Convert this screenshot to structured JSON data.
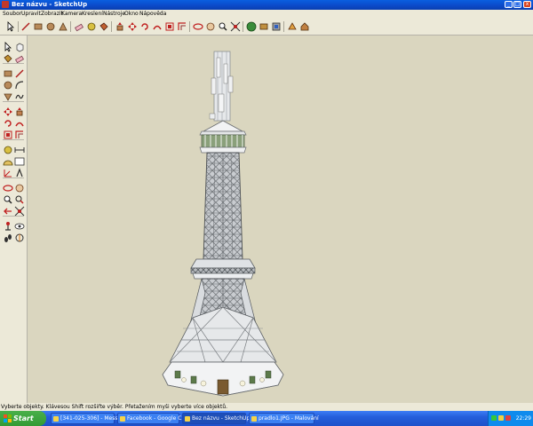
{
  "window": {
    "title": "Bez názvu - SketchUp",
    "min_label": "_",
    "max_label": "□",
    "close_label": "x"
  },
  "menu": [
    "Soubor",
    "Upravit",
    "Zobrazit",
    "Kamera",
    "Kreslení",
    "Nástroje",
    "Okno",
    "Nápověda"
  ],
  "toolbar_icons": [
    "select-icon",
    "line-icon",
    "rectangle-icon",
    "circle-icon",
    "polygon-icon",
    "eraser-icon",
    "tape-measure-icon",
    "paint-bucket-icon",
    "push-pull-icon",
    "move-icon",
    "rotate-icon",
    "follow-me-icon",
    "scale-icon",
    "offset-icon",
    "orbit-icon",
    "pan-icon",
    "zoom-icon",
    "zoom-extents-icon",
    "get-models-icon",
    "share-model-icon",
    "component-icon",
    "section-icon"
  ],
  "status": {
    "text": "Vyberte objekty. Klávesou Shift rozšiřte výběr. Přetažením myši vyberte více objektů."
  },
  "taskbar": {
    "start_label": "Start",
    "tasks": [
      {
        "label": "[341-025-306] - Mess..."
      },
      {
        "label": "Facebook - Google C..."
      },
      {
        "label": "Bez názvu - SketchUp"
      },
      {
        "label": "pradlo1.JPG - Malování"
      }
    ],
    "clock": "22:29"
  },
  "colors": {
    "title_bar": "#0b49c8",
    "viewport_bg": "#dad6bf",
    "tower_steel": "#8a8e92",
    "tower_white": "#eef0f2",
    "tower_window": "#6b8c5a",
    "taskbar": "#245edb",
    "start_button": "#339a34"
  }
}
